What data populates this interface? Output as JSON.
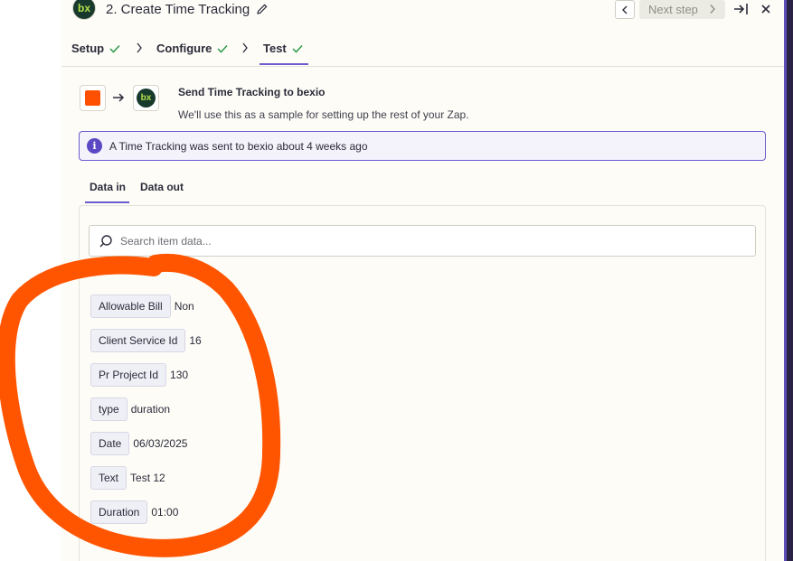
{
  "header": {
    "app_logo_text": "bx",
    "title": "2. Create Time Tracking",
    "next_label": "Next step"
  },
  "steps": [
    {
      "label": "Setup"
    },
    {
      "label": "Configure"
    },
    {
      "label": "Test"
    }
  ],
  "send": {
    "title": "Send Time Tracking to bexio",
    "subtitle": "We'll use this as a sample for setting up the rest of your Zap.",
    "app_icon_text": "bx"
  },
  "banner": {
    "text": "A Time Tracking was sent to bexio about 4 weeks ago"
  },
  "data_tabs": {
    "data_in": "Data in",
    "data_out": "Data out"
  },
  "search": {
    "placeholder": "Search item data..."
  },
  "fields": [
    {
      "label": "Allowable Bill",
      "value": "Non"
    },
    {
      "label": "Client Service Id",
      "value": "16"
    },
    {
      "label": "Pr Project Id",
      "value": "130"
    },
    {
      "label": "type",
      "value": "duration"
    },
    {
      "label": "Date",
      "value": "06/03/2025"
    },
    {
      "label": "Text",
      "value": "Test 12"
    },
    {
      "label": "Duration",
      "value": "01:00"
    }
  ],
  "colors": {
    "accent": "#6a5ccf",
    "annotation": "#ff5500",
    "zapier_orange": "#ff4f00",
    "check": "#2e9a4a"
  }
}
